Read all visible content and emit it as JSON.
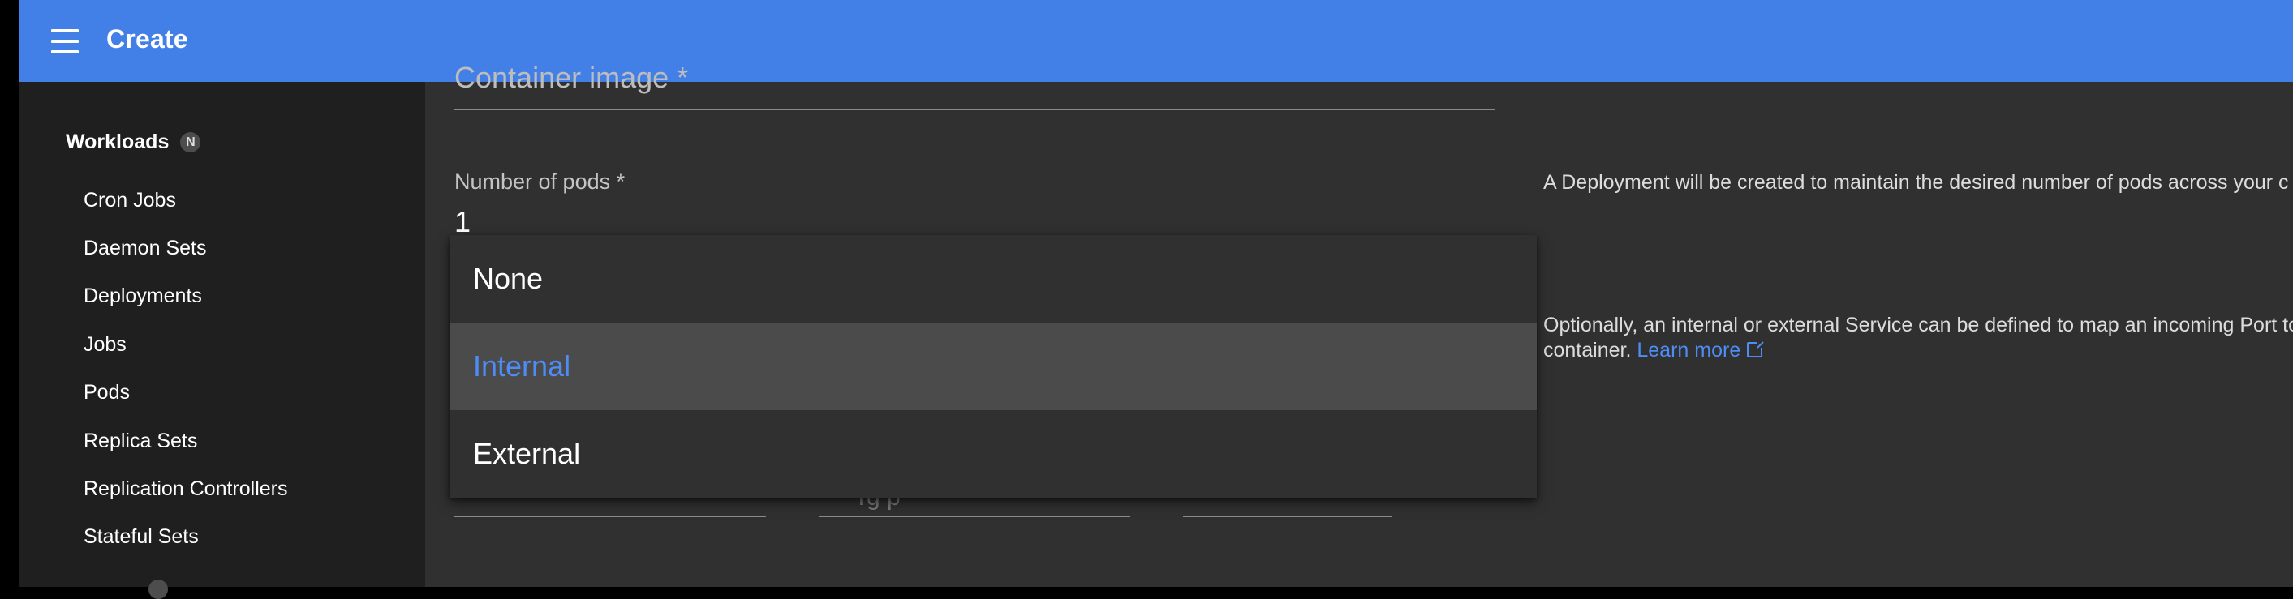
{
  "header": {
    "title": "Create",
    "menu_icon": "hamburger-menu-icon",
    "color": "#4280e8"
  },
  "sidebar": {
    "group_label": "Workloads",
    "group_badge": "N",
    "items": [
      "Cron Jobs",
      "Daemon Sets",
      "Deployments",
      "Jobs",
      "Pods",
      "Replica Sets",
      "Replication Controllers",
      "Stateful Sets"
    ]
  },
  "form": {
    "container_image_label": "Container image *",
    "pods_label": "Number of pods *",
    "pods_value": "1",
    "deployment_help": "A Deployment will be created to maintain the desired number of pods across your c",
    "service_help_line1": "Optionally, an internal or external Service can be defined to map an incoming Port to",
    "service_help_line2": "container.",
    "learn_more": "Learn more",
    "obscured_field_text": "rg p"
  },
  "service_dropdown": {
    "options": [
      "None",
      "Internal",
      "External"
    ],
    "selected": "Internal",
    "selected_color": "#4e8cf6"
  }
}
